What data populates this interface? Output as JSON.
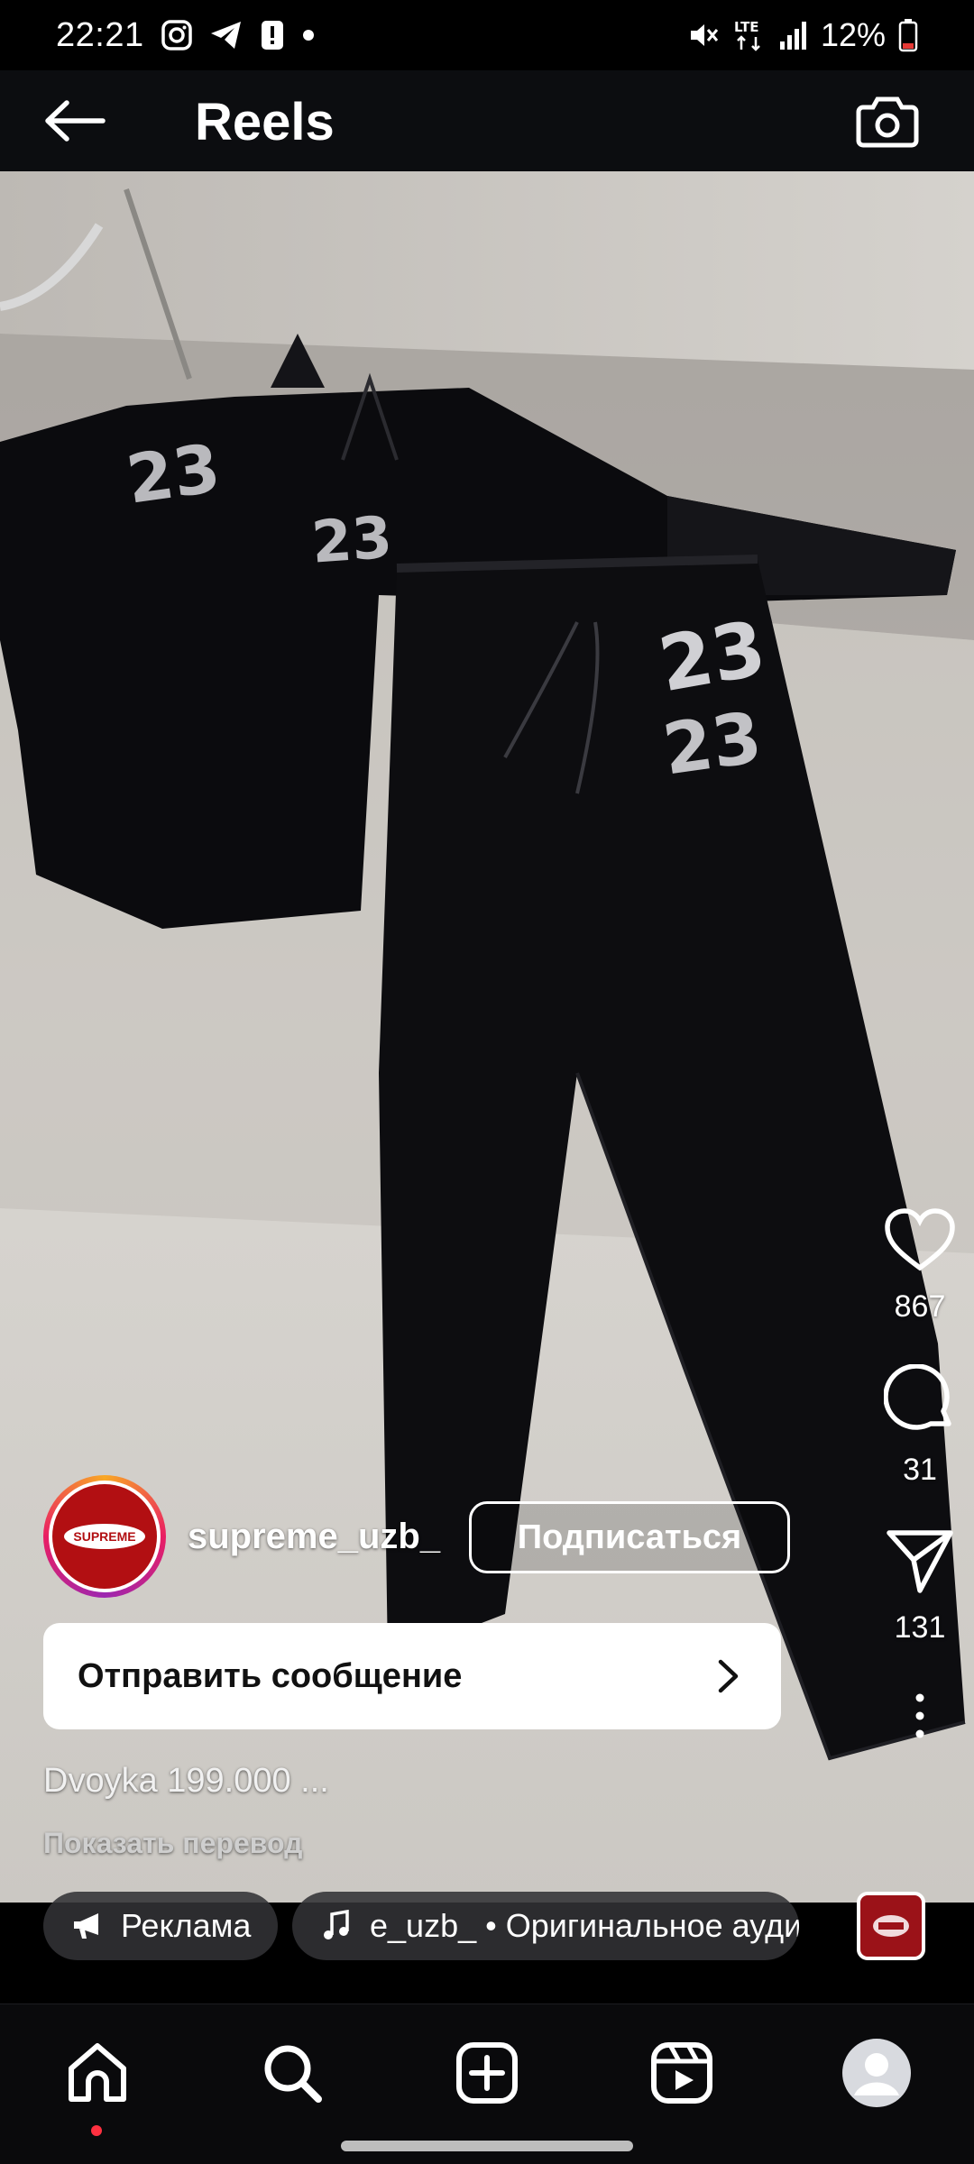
{
  "status_bar": {
    "time": "22:21",
    "network": "LTE",
    "battery": "12%",
    "left_icons": [
      "instagram-icon",
      "telegram-icon",
      "alert-icon",
      "dot-icon"
    ],
    "right_icons": [
      "mute-icon",
      "lte-icon",
      "signal-icon",
      "battery-icon"
    ]
  },
  "header": {
    "title": "Reels",
    "back_icon": "arrow-left-icon",
    "camera_icon": "camera-icon"
  },
  "media": {
    "jersey_numbers": [
      "23",
      "23",
      "23",
      "23"
    ]
  },
  "actions": {
    "like_count": "867",
    "comment_count": "31",
    "share_count": "131",
    "icons": [
      "heart-icon",
      "comment-icon",
      "send-icon",
      "more-vertical-icon"
    ]
  },
  "author": {
    "username": "supreme_uzb_",
    "avatar_text": "SUPREME",
    "follow_label": "Подписаться"
  },
  "message": {
    "label": "Отправить сообщение"
  },
  "caption": {
    "text": "Dvoyka 199.000 ...",
    "translate": "Показать перевод"
  },
  "chips": {
    "ad_label": "Реклама",
    "audio_label": "e_uzb_ • Оригинальное ауди"
  },
  "bottom_nav": {
    "items": [
      "home-icon",
      "search-icon",
      "create-icon",
      "reels-icon",
      "profile-icon"
    ]
  },
  "colors": {
    "background": "#000000",
    "header": "#0c0d10",
    "accent_red": "#ff3040",
    "avatar_red": "#b20f12"
  }
}
